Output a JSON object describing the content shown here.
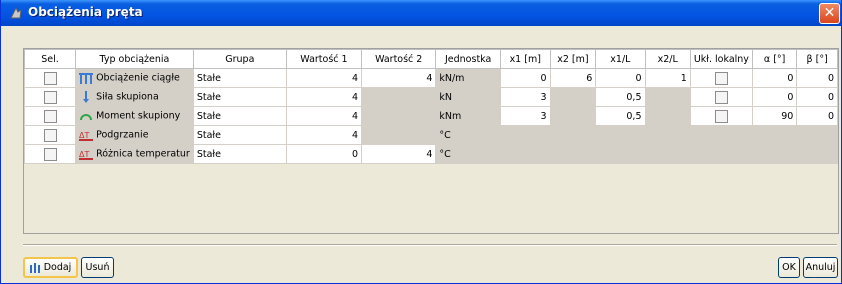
{
  "window": {
    "title": "Obciążenia pręta"
  },
  "columns": [
    "Sel.",
    "Typ obciążenia",
    "Grupa",
    "Wartość 1",
    "Wartość 2",
    "Jednostka",
    "x1 [m]",
    "x2 [m]",
    "x1/L",
    "x2/L",
    "Ukł. lokalny",
    "α [°]",
    "β [°]"
  ],
  "rows": [
    {
      "type": "Obciążenie ciągłe",
      "icon": "distributed-load-icon",
      "group": "Stałe",
      "v1": "4",
      "v2": "4",
      "unit": "kN/m",
      "x1": "0",
      "x2": "6",
      "x1L": "0",
      "x2L": "1",
      "alpha": "0",
      "beta": "0"
    },
    {
      "type": "Siła skupiona",
      "icon": "point-force-icon",
      "group": "Stałe",
      "v1": "4",
      "v2": "",
      "unit": "kN",
      "x1": "3",
      "x2": "",
      "x1L": "0,5",
      "x2L": "",
      "alpha": "0",
      "beta": "0"
    },
    {
      "type": "Moment skupiony",
      "icon": "moment-icon",
      "group": "Stałe",
      "v1": "4",
      "v2": "",
      "unit": "kNm",
      "x1": "3",
      "x2": "",
      "x1L": "0,5",
      "x2L": "",
      "alpha": "90",
      "beta": "0"
    },
    {
      "type": "Podgrzanie",
      "icon": "temperature-icon",
      "group": "Stałe",
      "v1": "4",
      "v2": "",
      "unit": "°C",
      "x1": "",
      "x2": "",
      "x1L": "",
      "x2L": "",
      "alpha": "",
      "beta": ""
    },
    {
      "type": "Różnica temperatur",
      "icon": "temperature-difference-icon",
      "group": "Stałe",
      "v1": "0",
      "v2": "4",
      "unit": "°C",
      "x1": "",
      "x2": "",
      "x1L": "",
      "x2L": "",
      "alpha": "",
      "beta": ""
    }
  ],
  "buttons": {
    "add": "Dodaj",
    "remove": "Usuń",
    "ok": "OK",
    "cancel": "Anuluj"
  },
  "colors": {
    "titlebar": "#0354e3",
    "readonly_cell": "#d4d0c8",
    "close": "#d9451c"
  }
}
